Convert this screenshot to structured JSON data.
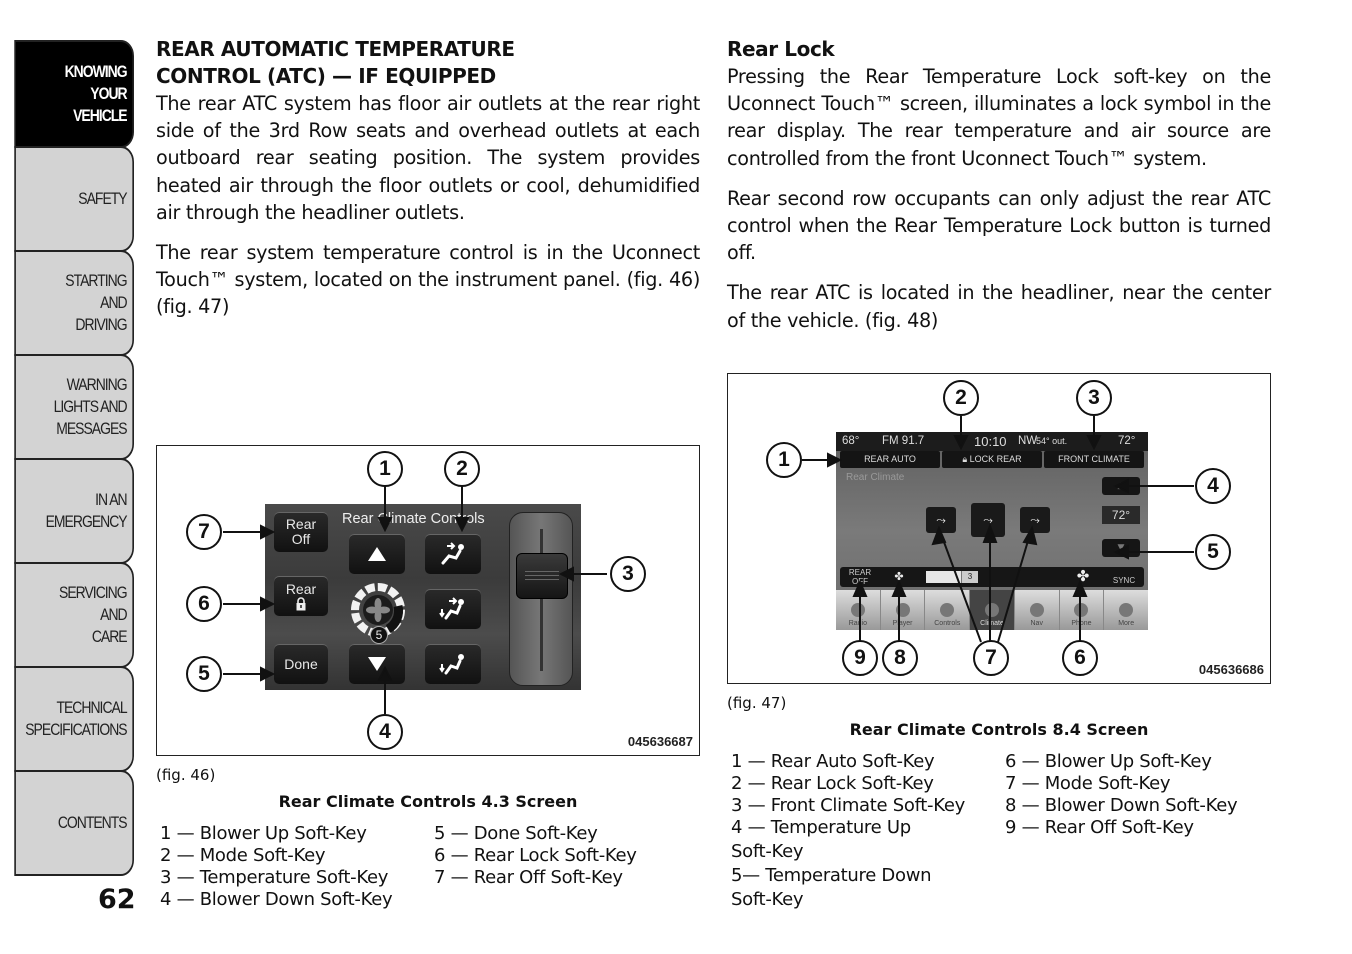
{
  "sidebar": {
    "tabs": [
      {
        "label": "KNOWING\nYOUR\nVEHICLE",
        "active": true
      },
      {
        "label": "SAFETY",
        "active": false
      },
      {
        "label": "STARTING\nAND\nDRIVING",
        "active": false
      },
      {
        "label": "WARNING\nLIGHTS AND\nMESSAGES",
        "active": false
      },
      {
        "label": "IN AN\nEMERGENCY",
        "active": false
      },
      {
        "label": "SERVICING\nAND\nCARE",
        "active": false
      },
      {
        "label": "TECHNICAL\nSPECIFICATIONS",
        "active": false
      },
      {
        "label": "CONTENTS",
        "active": false
      }
    ],
    "page_number": "62"
  },
  "left_column": {
    "heading_line1": "REAR AUTOMATIC TEMPERATURE",
    "heading_line2": "CONTROL (ATC) — IF EQUIPPED",
    "paragraphs": [
      "The rear ATC system has floor air outlets at the rear right side of the 3rd Row seats and overhead outlets at each outboard rear seating position. The system provides heated air through the floor outlets or cool, dehumidified air through the headliner outlets.",
      "The rear system temperature control is in the Uconnect Touch™ system, located on the instrument panel. (fig.  46)  (fig.  47)"
    ]
  },
  "right_column": {
    "heading": "Rear Lock",
    "paragraphs": [
      "Pressing the Rear Temperature Lock soft-key on the Uconnect Touch™ screen, illuminates a lock symbol in the rear display. The rear temperature and air source are controlled from the front Uconnect Touch™ system.",
      "Rear second row occupants can only adjust the rear ATC control when the Rear Temperature Lock button is turned off.",
      "The rear ATC is located in the headliner, near the center of the vehicle. (fig.  48)"
    ]
  },
  "figure46": {
    "code": "045636687",
    "screen_title": "Rear Climate Controls",
    "keys": {
      "rear_off": "Rear\nOff",
      "rear_lock": "Rear",
      "done": "Done",
      "blower_level": "5"
    },
    "icons": [
      "up-triangle-icon",
      "down-triangle-icon",
      "fan-icon",
      "lock-icon",
      "mode-headliner-icon",
      "mode-bilevel-icon",
      "mode-floor-icon"
    ],
    "callouts": [
      "1",
      "2",
      "3",
      "4",
      "5",
      "6",
      "7"
    ],
    "tag": "(fig. 46)",
    "caption": "Rear Climate Controls 4.3 Screen",
    "legend_col1": [
      "1 — Blower Up Soft-Key",
      "2 — Mode Soft-Key",
      "3 — Temperature Soft-Key",
      "4 — Blower Down Soft-Key"
    ],
    "legend_col2": [
      "5 — Done Soft-Key",
      "6 — Rear Lock Soft-Key",
      "7 — Rear Off Soft-Key"
    ]
  },
  "figure47": {
    "code": "045636686",
    "status": {
      "left_temp": "68°",
      "radio": "FM 91.7",
      "time": "10:10",
      "compass": "NW",
      "outside": "54° out.",
      "right_temp": "72°"
    },
    "tabs": [
      "REAR AUTO",
      "LOCK REAR",
      "FRONT CLIMATE"
    ],
    "screen_label": "Rear Climate",
    "temperature": "72°",
    "bottom_bar": {
      "rear_off": "REAR\nOFF",
      "blower_level": "3",
      "sync": "SYNC"
    },
    "nav": [
      "Radio",
      "Player",
      "Controls",
      "Climate",
      "Nav",
      "Phone",
      "More"
    ],
    "callouts": [
      "1",
      "2",
      "3",
      "4",
      "5",
      "6",
      "7",
      "8",
      "9"
    ],
    "tag": "(fig. 47)",
    "caption": "Rear Climate Controls 8.4 Screen",
    "legend_col1": [
      "1 — Rear Auto Soft-Key",
      "2 — Rear Lock Soft-Key",
      "3 — Front Climate Soft-Key",
      "4 — Temperature Up",
      "Soft-Key",
      "5— Temperature Down",
      "Soft-Key"
    ],
    "legend_col2": [
      "6 — Blower Up Soft-Key",
      "7 — Mode Soft-Key",
      "8 — Blower Down Soft-Key",
      "9 — Rear Off Soft-Key"
    ]
  }
}
